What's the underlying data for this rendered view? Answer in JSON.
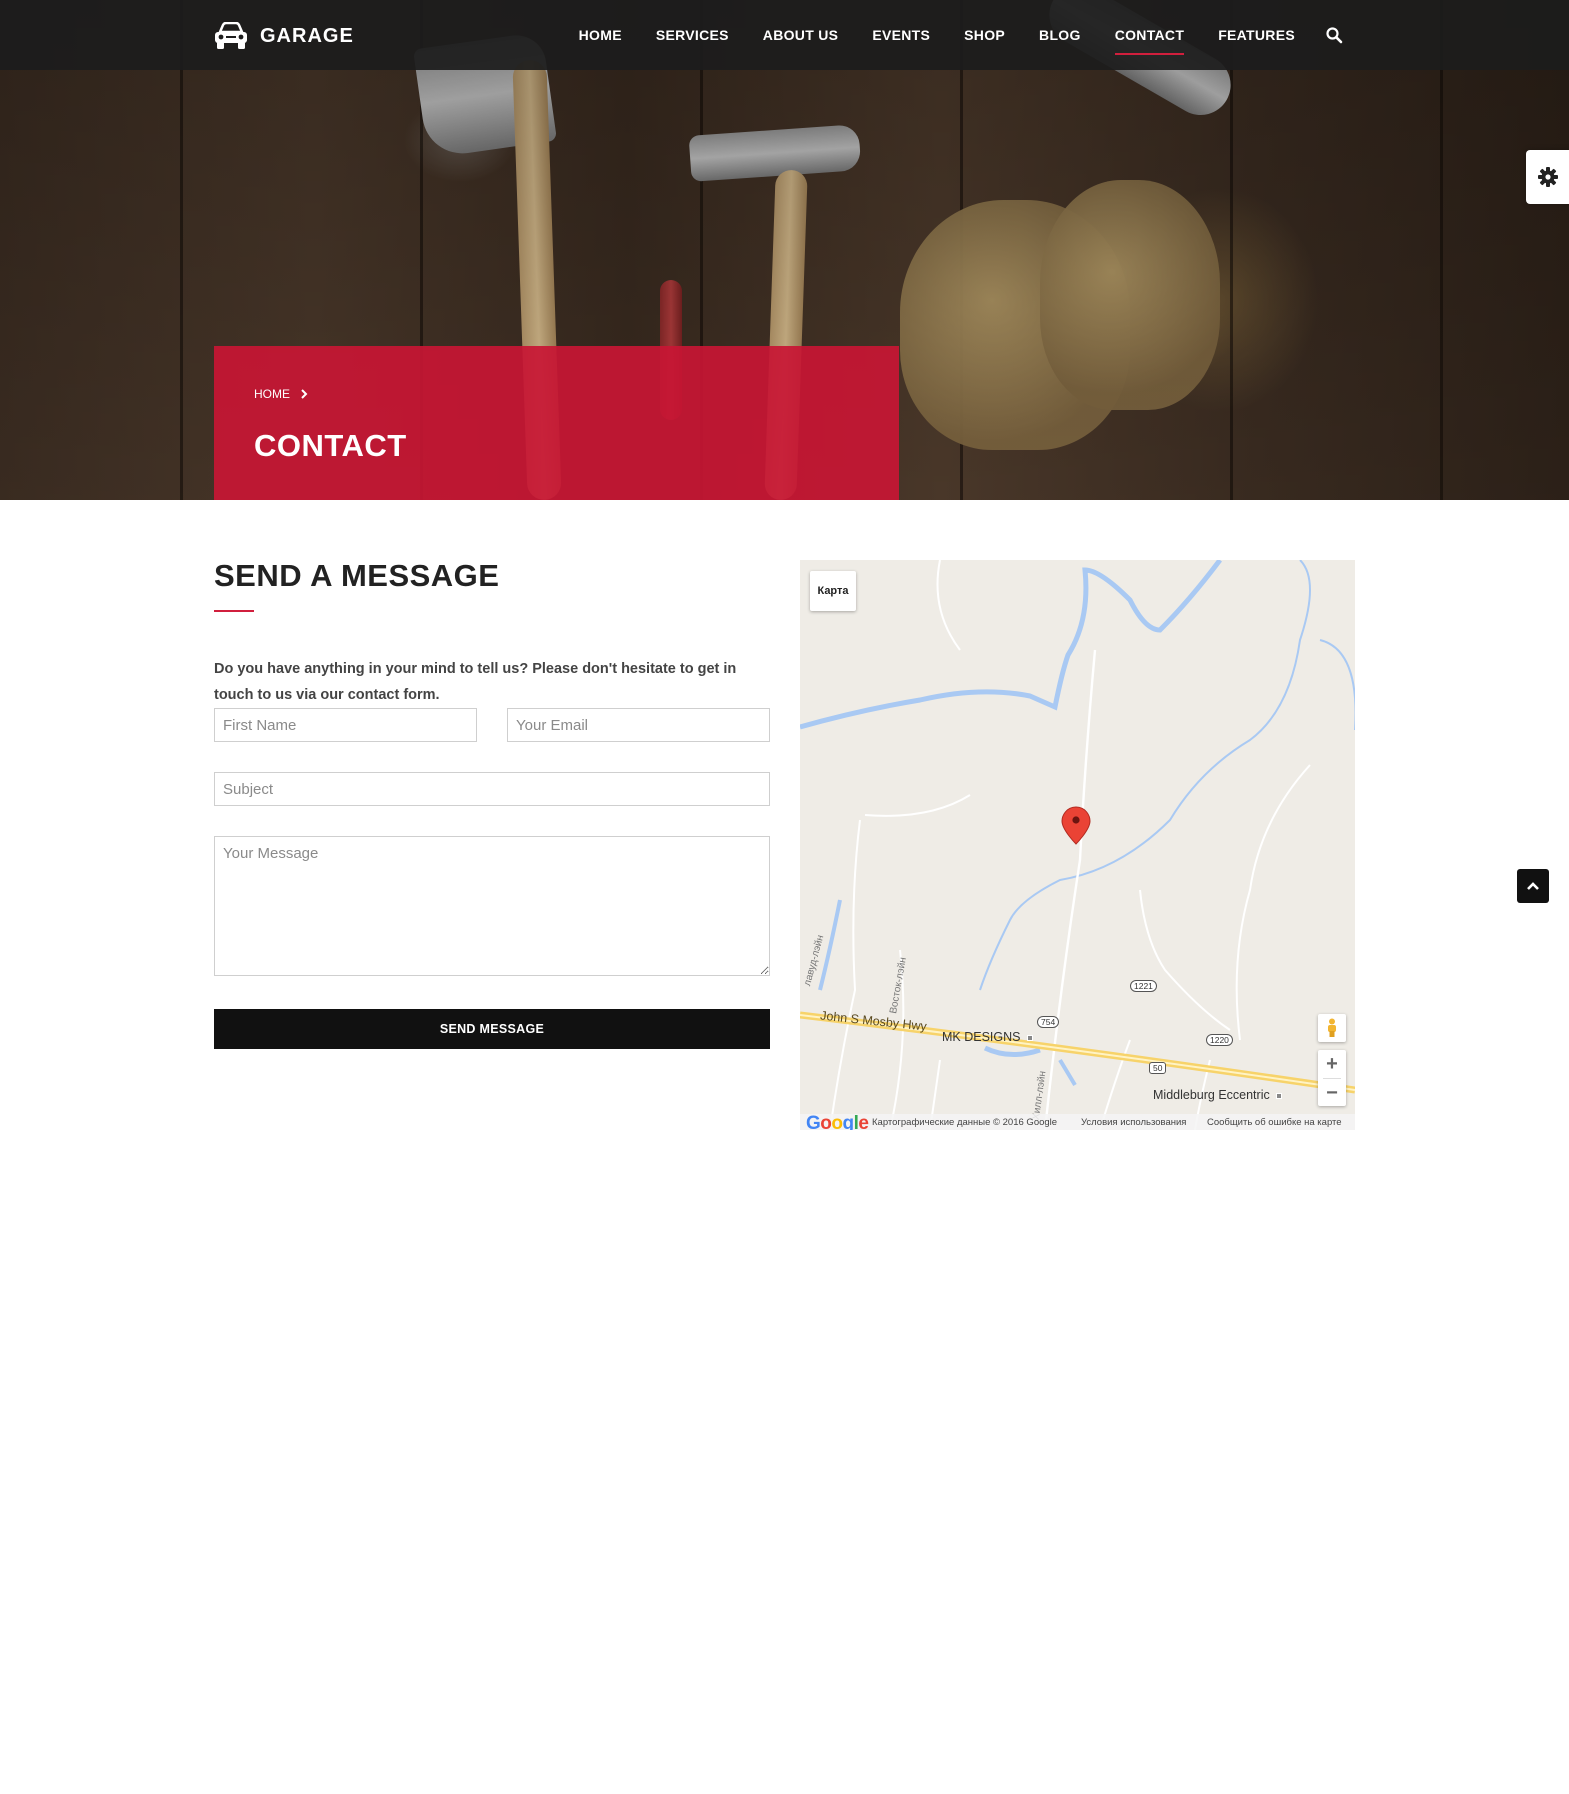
{
  "brand": {
    "name": "GARAGE"
  },
  "nav": {
    "items": [
      {
        "label": "HOME",
        "active": false
      },
      {
        "label": "SERVICES",
        "active": false
      },
      {
        "label": "ABOUT US",
        "active": false
      },
      {
        "label": "EVENTS",
        "active": false
      },
      {
        "label": "SHOP",
        "active": false
      },
      {
        "label": "BLOG",
        "active": false
      },
      {
        "label": "CONTACT",
        "active": true
      },
      {
        "label": "FEATURES",
        "active": false
      }
    ]
  },
  "hero": {
    "breadcrumb": "HOME",
    "title": "CONTACT"
  },
  "form": {
    "title": "SEND A MESSAGE",
    "intro": "Do you have anything in your mind to tell us? Please don't hesitate to get in touch to us via our contact form.",
    "first_name_placeholder": "First Name",
    "email_placeholder": "Your Email",
    "subject_placeholder": "Subject",
    "message_placeholder": "Your Message",
    "submit_label": "SEND MESSAGE"
  },
  "map": {
    "type_button": "Карта",
    "place_labels": [
      "MK DESIGNS",
      "Middleburg Eccentric"
    ],
    "road_labels": [
      "John S Mosby Hwy",
      "Восток-лэйн",
      "Хилл-лэйн",
      "лавуд-лэйн"
    ],
    "route_shields": [
      "754",
      "1221",
      "1220",
      "50"
    ],
    "google_logo": "Google",
    "attribution": "Картографические данные © 2016 Google",
    "terms": "Условия использования",
    "report": "Сообщить об ошибке на карте",
    "zoom_in": "+",
    "zoom_out": "−"
  },
  "colors": {
    "accent": "#d11f3d",
    "banner": "#c81634",
    "nav_bg": "#1c1c1c",
    "button": "#111111",
    "water": "#a9c9f3",
    "map_bg": "#efece6"
  }
}
